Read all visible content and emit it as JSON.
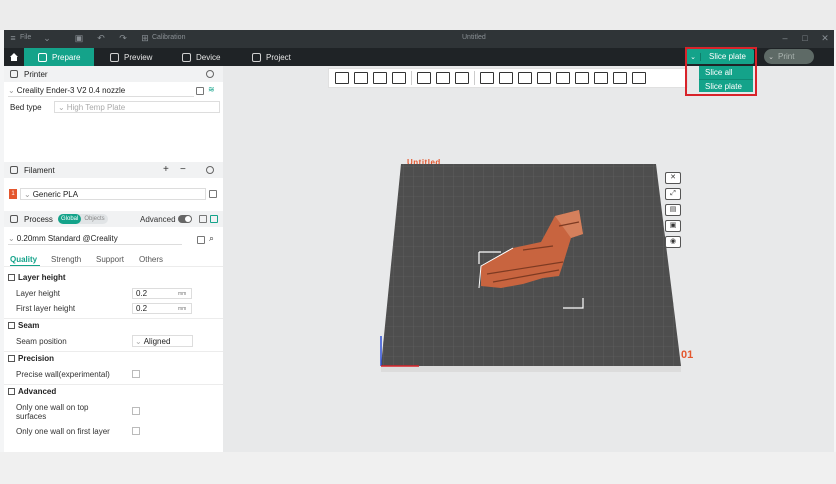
{
  "titlebar": {
    "file_menu": "File",
    "calibration": "Calibration",
    "document_title": "Untitled"
  },
  "tabs": [
    {
      "label": "Prepare",
      "active": true
    },
    {
      "label": "Preview"
    },
    {
      "label": "Device"
    },
    {
      "label": "Project"
    }
  ],
  "slice": {
    "button_label": "Slice plate",
    "print_label": "Print",
    "dropdown": [
      "Slice all",
      "Slice plate"
    ]
  },
  "printer": {
    "section_title": "Printer",
    "name": "Creality Ender-3 V2 0.4 nozzle",
    "bed_type_label": "Bed type",
    "bed_type_value": "High Temp Plate"
  },
  "filament": {
    "section_title": "Filament",
    "slot_number": "1",
    "name": "Generic PLA",
    "add": "+",
    "remove": "−"
  },
  "process": {
    "section_title": "Process",
    "pill_global": "Global",
    "pill_objects": "Objects",
    "advanced_label": "Advanced",
    "preset": "0.20mm Standard @Creality",
    "tabs": [
      "Quality",
      "Strength",
      "Support",
      "Others"
    ]
  },
  "settings": {
    "layer_height_group": "Layer height",
    "layer_height_label": "Layer height",
    "layer_height_value": "0.2",
    "first_layer_label": "First layer height",
    "first_layer_value": "0.2",
    "unit": "mm",
    "seam_group": "Seam",
    "seam_position_label": "Seam position",
    "seam_position_value": "Aligned",
    "precision_group": "Precision",
    "precise_wall_label": "Precise wall(experimental)",
    "advanced_group": "Advanced",
    "one_wall_top_label": "Only one wall on top surfaces",
    "one_wall_first_label": "Only one wall on first layer"
  },
  "viewport": {
    "plate_title": "Untitled",
    "plate_number": "01"
  },
  "colors": {
    "accent": "#14a38a",
    "model": "#c8643f",
    "plate": "#4e4e4e",
    "highlight": "#d8232a"
  }
}
